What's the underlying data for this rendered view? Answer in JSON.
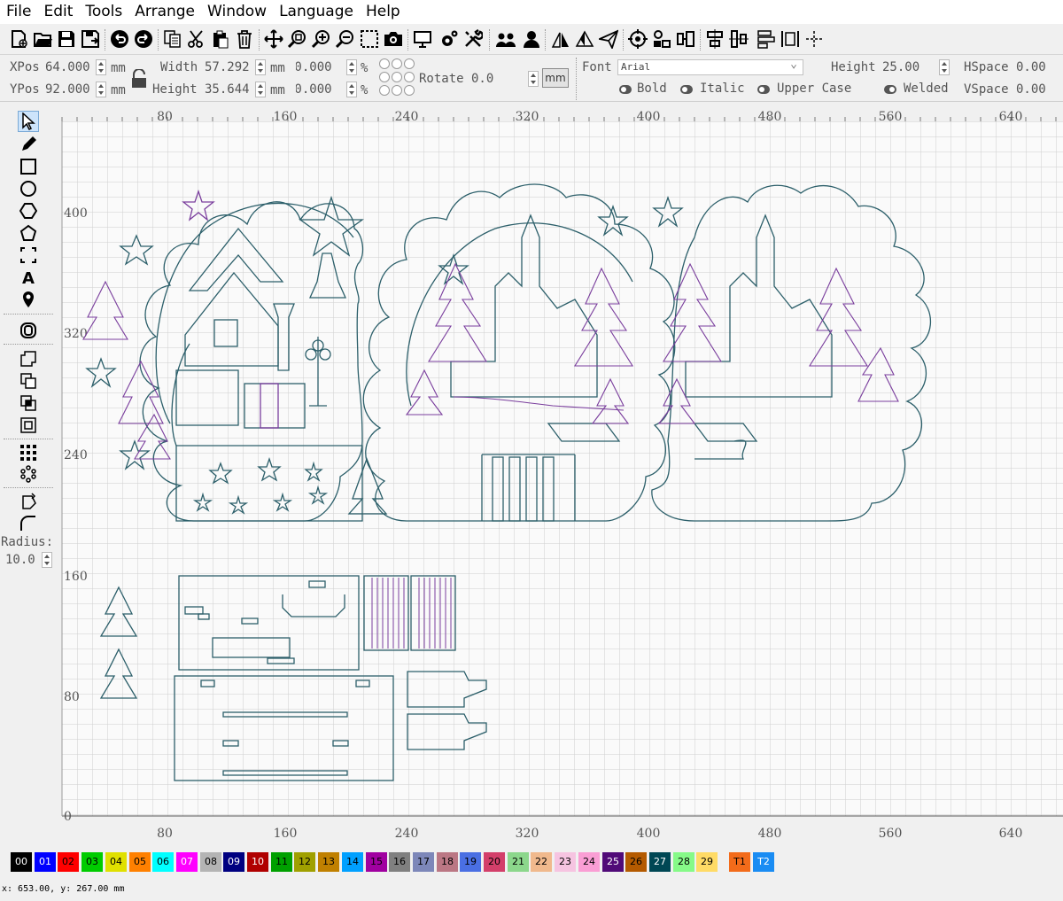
{
  "menu": [
    "File",
    "Edit",
    "Tools",
    "Arrange",
    "Window",
    "Language",
    "Help"
  ],
  "toolbar": {
    "icons": [
      "new-icon",
      "open-icon",
      "save-icon",
      "save-as-icon",
      "undo-icon",
      "redo-icon",
      "copy-icon",
      "cut-icon",
      "paste-icon",
      "delete-icon",
      "move-icon",
      "zoom-fit-icon",
      "zoom-in-icon",
      "zoom-out-icon",
      "select-frame-icon",
      "camera-icon",
      "monitor-icon",
      "settings-icon",
      "tools-icon",
      "group-icon",
      "user-icon",
      "mirror-h-icon",
      "mirror-v-icon",
      "send-icon",
      "target-icon",
      "align-icon",
      "distribute-icon",
      "align-center-icon",
      "align-middle-icon",
      "arrange-icon",
      "distribute-h-icon"
    ]
  },
  "properties": {
    "xpos_label": "XPos",
    "xpos_value": "64.000",
    "ypos_label": "YPos",
    "ypos_value": "92.000",
    "unit": "mm",
    "width_label": "Width",
    "width_value": "57.292",
    "height_label": "Height",
    "height_value": "35.644",
    "scale_w": "00.000",
    "scale_h": "00.000",
    "percent": "%",
    "rotate_label": "Rotate",
    "rotate_value": "0.0",
    "unit_button": "mm",
    "font_label": "Font",
    "font_value": "Arial",
    "text_height_label": "Height",
    "text_height_value": "25.00",
    "hspace_label": "HSpace",
    "hspace_value": "0.00",
    "vspace_label": "VSpace",
    "vspace_value": "0.00",
    "bold": "Bold",
    "italic": "Italic",
    "upper_case": "Upper Case",
    "welded": "Welded"
  },
  "tools": {
    "icons": [
      "select-icon",
      "pencil-icon",
      "rectangle-icon",
      "ellipse-icon",
      "polygon-icon",
      "pentagon-icon",
      "frame-icon",
      "text-icon",
      "location-icon",
      "offset-icon",
      "boolean-union-icon",
      "boolean-subtract-icon",
      "boolean-intersect-icon",
      "boolean-exclusion-icon",
      "grid-array-icon",
      "circular-array-icon",
      "rotate-icon",
      "corner-radius-icon"
    ],
    "radius_label": "Radius:",
    "radius_value": "10.0"
  },
  "canvas": {
    "ruler_top": [
      "80",
      "160",
      "240",
      "320",
      "400",
      "480",
      "560",
      "640"
    ],
    "ruler_bottom": [
      "80",
      "160",
      "240",
      "320",
      "400",
      "480",
      "560",
      "640"
    ],
    "ruler_left": [
      "400",
      "320",
      "240",
      "160",
      "80",
      "0"
    ]
  },
  "palette": [
    {
      "label": "00",
      "color": "#000000",
      "text": "#ffffff"
    },
    {
      "label": "01",
      "color": "#0000ff",
      "text": "#ffffff"
    },
    {
      "label": "02",
      "color": "#ff0000",
      "text": "#000000"
    },
    {
      "label": "03",
      "color": "#00cc00",
      "text": "#000000"
    },
    {
      "label": "04",
      "color": "#e0e000",
      "text": "#000000"
    },
    {
      "label": "05",
      "color": "#ff8000",
      "text": "#000000"
    },
    {
      "label": "06",
      "color": "#00ffff",
      "text": "#000000"
    },
    {
      "label": "07",
      "color": "#ff00ff",
      "text": "#ffffff"
    },
    {
      "label": "08",
      "color": "#b4b4b4",
      "text": "#000000"
    },
    {
      "label": "09",
      "color": "#000080",
      "text": "#ffffff"
    },
    {
      "label": "10",
      "color": "#b00000",
      "text": "#ffffff"
    },
    {
      "label": "11",
      "color": "#00a000",
      "text": "#000000"
    },
    {
      "label": "12",
      "color": "#a0a000",
      "text": "#000000"
    },
    {
      "label": "13",
      "color": "#c08000",
      "text": "#000000"
    },
    {
      "label": "14",
      "color": "#00a0ff",
      "text": "#000000"
    },
    {
      "label": "15",
      "color": "#a000a0",
      "text": "#000000"
    },
    {
      "label": "16",
      "color": "#808080",
      "text": "#000000"
    },
    {
      "label": "17",
      "color": "#7d87b9",
      "text": "#000000"
    },
    {
      "label": "18",
      "color": "#bb7784",
      "text": "#000000"
    },
    {
      "label": "19",
      "color": "#4a6fe3",
      "text": "#000000"
    },
    {
      "label": "20",
      "color": "#d33f6a",
      "text": "#000000"
    },
    {
      "label": "21",
      "color": "#8cd78c",
      "text": "#000000"
    },
    {
      "label": "22",
      "color": "#f0b98d",
      "text": "#000000"
    },
    {
      "label": "23",
      "color": "#f6c4e1",
      "text": "#000000"
    },
    {
      "label": "24",
      "color": "#fa9ed4",
      "text": "#000000"
    },
    {
      "label": "25",
      "color": "#500a78",
      "text": "#ffffff"
    },
    {
      "label": "26",
      "color": "#b45a00",
      "text": "#000000"
    },
    {
      "label": "27",
      "color": "#004754",
      "text": "#ffffff"
    },
    {
      "label": "28",
      "color": "#86fa88",
      "text": "#000000"
    },
    {
      "label": "29",
      "color": "#ffdb66",
      "text": "#000000"
    },
    {
      "label": "T1",
      "color": "#f36b1a",
      "text": "#000000"
    },
    {
      "label": "T2",
      "color": "#1a8cf3",
      "text": "#ffffff"
    }
  ],
  "status": "x: 653.00, y: 267.00 mm",
  "colors": {
    "cut_line": "#2c5f6a",
    "engrave_line": "#7a3e9d",
    "grid": "#cfcfcf"
  }
}
